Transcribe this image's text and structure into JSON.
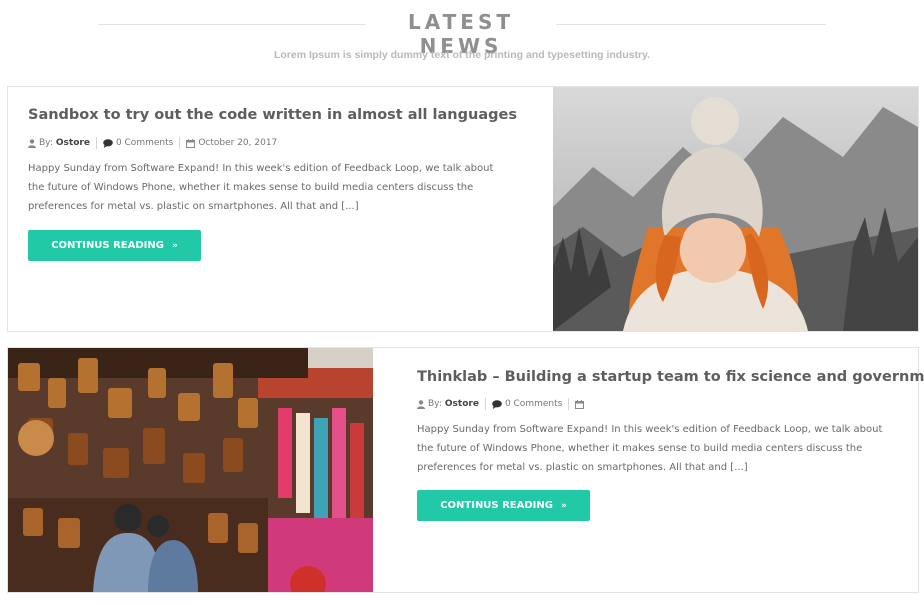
{
  "section": {
    "title": "LATEST NEWS",
    "subtitle": "Lorem Ipsum is simply dummy text of the printing and typesetting industry."
  },
  "posts": [
    {
      "title": "Sandbox to try out the code written in almost all languages",
      "by_label": "By:",
      "author": "Ostore",
      "comments": "0 Comments",
      "date": "October 20, 2017",
      "excerpt_lines": [
        "Happy Sunday from Software Expand! In this week's edition of Feedback Loop, we talk about",
        "the future of Windows Phone, whether it makes sense to build media centers discuss the",
        "preferences for metal vs. plastic on smartphones. All that and [...]"
      ],
      "button": "CONTINUS READING",
      "image_icon": "girl-in-knit-hat-photo"
    },
    {
      "title": "Thinklab – Building a startup team to fix science and government",
      "by_label": "By:",
      "author": "Ostore",
      "comments": "0 Comments",
      "date": "",
      "excerpt_lines": [
        "Happy Sunday from Software Expand! In this week's edition of Feedback Loop, we talk about",
        "the future of Windows Phone, whether it makes sense to build media centers discuss the",
        "preferences for metal vs. plastic on smartphones. All that and [...]"
      ],
      "button": "CONTINUS READING",
      "image_icon": "market-bags-photo"
    }
  ],
  "colors": {
    "accent": "#21c9a7",
    "title": "#5e5e5e",
    "heading": "#8f8f8f"
  }
}
